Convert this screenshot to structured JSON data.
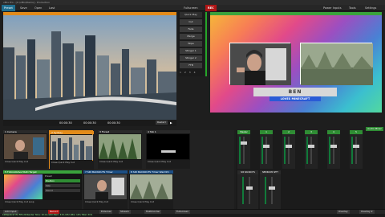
{
  "titlebar": {
    "title": "vMix Pro - [C:\\vMix\\Demo] - Production"
  },
  "menubar": {
    "items": [
      "Preset",
      "Save",
      "Open",
      "Last"
    ],
    "right": [
      "Fullscreen",
      "External",
      "Stream",
      "Multicorder",
      "Record",
      "Playlist"
    ],
    "right_top": [
      "Fullscreen",
      "REC",
      "Power Inputs",
      "Tools",
      "Settings"
    ]
  },
  "preview": {
    "label": "Preview",
    "timecode_left": "00:00:30",
    "timecode_mid": "00:00:30",
    "timecode_right": "00:00:30",
    "restart_label": "Restart"
  },
  "quickplay": {
    "title": "Quick Play",
    "buttons": [
      "Cut",
      "Fade",
      "Merge",
      "Wipe",
      "Stinger 1",
      "Stinger 2",
      "FTB"
    ],
    "numbers": [
      "1",
      "2",
      "3",
      "4"
    ]
  },
  "output": {
    "label": "TLSinstAlive Multi Viewer",
    "nameplate_name": "BEN",
    "nameplate_sub": "LOVES MINECRAFT",
    "sidebar_badge": "REC"
  },
  "colors": {
    "accent_orange": "#e38b1b",
    "accent_green": "#3aa33c",
    "record_red": "#b01515",
    "swatches": [
      "#e02020",
      "#e08820",
      "#e0d020",
      "#20b020",
      "#2060e0",
      "#8020c0"
    ]
  },
  "inputs": [
    {
      "num": "1",
      "name": "Camera",
      "type": "Cam"
    },
    {
      "num": "2",
      "name": "Sydney",
      "type": "Video"
    },
    {
      "num": "3",
      "name": "Forest",
      "type": "Video"
    },
    {
      "num": "4",
      "name": "Tab 1",
      "type": "Video"
    },
    {
      "num": "5",
      "name": "TLSinstAlive Multi Target",
      "type": "Multi"
    },
    {
      "num": "6",
      "name": "SDI BLACKOUT",
      "type": "Colour"
    },
    {
      "num": "7",
      "name": "SDI BACKOUTS Timer",
      "type": "Timer"
    },
    {
      "num": "8",
      "name": "SDI BACKOUTS Timer Warmth",
      "type": "Timer"
    }
  ],
  "input_footer": {
    "close": "Close",
    "quick_play": "Quick Play",
    "cut": "Cut",
    "loop": "Loop"
  },
  "input5_panel": {
    "preset": "Preset",
    "values": [
      "Position",
      "Size",
      "Sound"
    ]
  },
  "mixer": {
    "title": "Audio Mixer",
    "strips": [
      "Master",
      "1",
      "2",
      "3",
      "4",
      "5"
    ],
    "sub_strips": [
      "SDI BACKOUTS",
      "NEWROOM SETT"
    ]
  },
  "bottombar": {
    "left": [
      "Add Input"
    ],
    "buttons": [
      "Record",
      "Stream",
      "External",
      "MultiCorder",
      "Fullscreen"
    ],
    "right": [
      "Overlay",
      "Overlay 2"
    ]
  },
  "status": {
    "text": "1080p29.97 EX FPS 29 Render Time: 10 ms GPU Mem: 31% CPU vMix: 14% Total: 31%"
  }
}
